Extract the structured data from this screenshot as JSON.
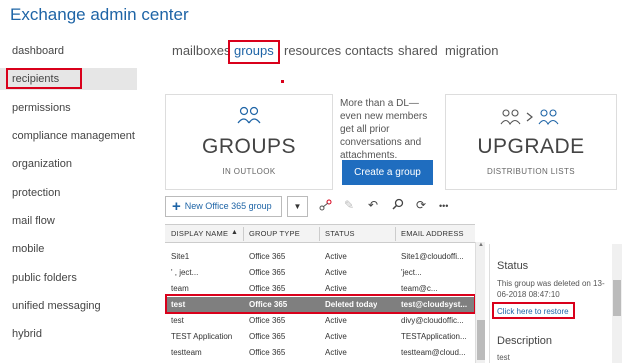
{
  "app_title": "Exchange admin center",
  "sidebar": {
    "items": [
      {
        "label": "dashboard"
      },
      {
        "label": "recipients"
      },
      {
        "label": "permissions"
      },
      {
        "label": "compliance management"
      },
      {
        "label": "organization"
      },
      {
        "label": "protection"
      },
      {
        "label": "mail flow"
      },
      {
        "label": "mobile"
      },
      {
        "label": "public folders"
      },
      {
        "label": "unified messaging"
      },
      {
        "label": "hybrid"
      }
    ],
    "active": "recipients"
  },
  "tabs": [
    {
      "label": "mailboxes"
    },
    {
      "label": "groups"
    },
    {
      "label": "resources"
    },
    {
      "label": "contacts"
    },
    {
      "label": "shared"
    },
    {
      "label": "migration"
    }
  ],
  "active_tab": "groups",
  "promo": {
    "groups_card": {
      "title": "GROUPS",
      "subtitle": "IN OUTLOOK"
    },
    "text": "More than a DL—even new members get all prior conversations and attachments.",
    "create_button": "Create a group",
    "upgrade_card": {
      "title": "UPGRADE",
      "subtitle": "DISTRIBUTION LISTS"
    }
  },
  "toolbar": {
    "new_button": "New Office 365 group",
    "more": "•••"
  },
  "table": {
    "columns": [
      "DISPLAY NAME",
      "GROUP TYPE",
      "STATUS",
      "EMAIL ADDRESS"
    ],
    "rows": [
      {
        "name": "Site1",
        "type": "Office 365",
        "status": "Active",
        "email": "Site1@cloudoffi..."
      },
      {
        "name": "' ,   ject...",
        "type": "Office 365",
        "status": "Active",
        "email": "'ject..."
      },
      {
        "name": "  team",
        "type": "Office 365",
        "status": "Active",
        "email": "team@c..."
      },
      {
        "name": "test",
        "type": "Office 365",
        "status": "Deleted today",
        "email": "test@cloudsyst...",
        "selected": true
      },
      {
        "name": "test",
        "type": "Office 365",
        "status": "Active",
        "email": "divy@cloudoffic..."
      },
      {
        "name": "TEST Application",
        "type": "Office 365",
        "status": "Active",
        "email": "TESTApplication..."
      },
      {
        "name": "testteam",
        "type": "Office 365",
        "status": "Active",
        "email": "testteam@cloud..."
      }
    ]
  },
  "details": {
    "status_heading": "Status",
    "status_text": "This group was deleted on 13-06-2018 08:47:10",
    "restore_link": "Click here to restore",
    "description_heading": "Description",
    "description_value": "test"
  },
  "colors": {
    "accent": "#1e64a6",
    "button": "#1f6dbf",
    "highlight": "#d9001b",
    "selected_row": "#7f7f7f"
  }
}
